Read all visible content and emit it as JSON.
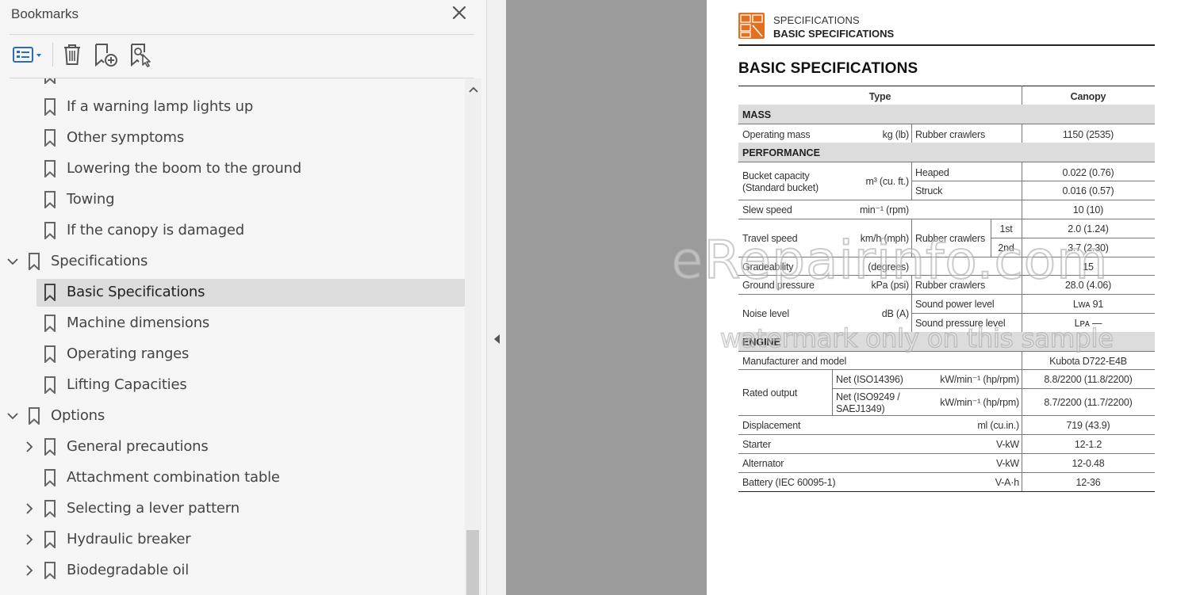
{
  "bookmarks_panel": {
    "title": "Bookmarks",
    "items": [
      {
        "label": "If a warning lamp lights up",
        "level": 2,
        "expandable": false,
        "expanded": false,
        "selected": false
      },
      {
        "label": "Other symptoms",
        "level": 2,
        "expandable": false,
        "expanded": false,
        "selected": false
      },
      {
        "label": "Lowering the boom to the ground",
        "level": 2,
        "expandable": false,
        "expanded": false,
        "selected": false
      },
      {
        "label": "Towing",
        "level": 2,
        "expandable": false,
        "expanded": false,
        "selected": false
      },
      {
        "label": "If the canopy is damaged",
        "level": 2,
        "expandable": false,
        "expanded": false,
        "selected": false
      },
      {
        "label": "Specifications",
        "level": 1,
        "expandable": true,
        "expanded": true,
        "selected": false
      },
      {
        "label": "Basic Specifications",
        "level": 2,
        "expandable": false,
        "expanded": false,
        "selected": true
      },
      {
        "label": "Machine dimensions",
        "level": 2,
        "expandable": false,
        "expanded": false,
        "selected": false
      },
      {
        "label": "Operating ranges",
        "level": 2,
        "expandable": false,
        "expanded": false,
        "selected": false
      },
      {
        "label": "Lifting Capacities",
        "level": 2,
        "expandable": false,
        "expanded": false,
        "selected": false
      },
      {
        "label": "Options",
        "level": 1,
        "expandable": true,
        "expanded": true,
        "selected": false
      },
      {
        "label": "General precautions",
        "level": 2,
        "expandable": true,
        "expanded": false,
        "selected": false
      },
      {
        "label": "Attachment combination table",
        "level": 2,
        "expandable": false,
        "expanded": false,
        "selected": false
      },
      {
        "label": "Selecting a lever pattern",
        "level": 2,
        "expandable": true,
        "expanded": false,
        "selected": false
      },
      {
        "label": "Hydraulic breaker",
        "level": 2,
        "expandable": true,
        "expanded": false,
        "selected": false
      },
      {
        "label": "Biodegradable oil",
        "level": 2,
        "expandable": true,
        "expanded": false,
        "selected": false
      }
    ],
    "toolbar_icons": [
      "options-list-icon",
      "delete-bookmark-icon",
      "new-bookmark-icon",
      "find-bookmark-icon"
    ]
  },
  "document": {
    "header_section": "SPECIFICATIONS",
    "header_subtitle": "BASIC SPECIFICATIONS",
    "page_title": "BASIC SPECIFICATIONS",
    "table": {
      "col_type": "Type",
      "col_canopy": "Canopy",
      "mass": {
        "section": "MASS",
        "operating_mass": "Operating mass",
        "operating_mass_unit": "kg (lb)",
        "operating_mass_cond": "Rubber crawlers",
        "operating_mass_val": "1150 (2535)"
      },
      "performance": {
        "section": "PERFORMANCE",
        "bucket_label_1": "Bucket capacity",
        "bucket_label_2": "(Standard bucket)",
        "bucket_unit": "m³ (cu. ft.)",
        "heaped": "Heaped",
        "heaped_val": "0.022 (0.76)",
        "struck": "Struck",
        "struck_val": "0.016 (0.57)",
        "slew": "Slew speed",
        "slew_unit": "min⁻¹ (rpm)",
        "slew_val": "10 (10)",
        "travel": "Travel speed",
        "travel_unit": "km/h (mph)",
        "travel_cond": "Rubber crawlers",
        "first": "1st",
        "first_val": "2.0 (1.24)",
        "second": "2nd",
        "second_val": "3.7 (2.30)",
        "grade": "Gradeability",
        "grade_unit": "(degrees)",
        "grade_val": "15",
        "ground": "Ground pressure",
        "ground_unit": "kPa (psi)",
        "ground_cond": "Rubber crawlers",
        "ground_val": "28.0 (4.06)",
        "noise": "Noise level",
        "noise_unit": "dB (A)",
        "sound_power": "Sound power level",
        "sound_power_val": "Lᴡᴀ 91",
        "sound_pressure": "Sound pressure level",
        "sound_pressure_val": "Lᴘᴀ —"
      },
      "engine": {
        "section": "ENGINE",
        "manufacturer": "Manufacturer and model",
        "manufacturer_val": "Kubota D722-E4B",
        "rated": "Rated output",
        "net_iso14396": "Net (ISO14396)",
        "net_iso14396_unit": "kW/min⁻¹ (hp/rpm)",
        "net_iso14396_val": "8.8/2200 (11.8/2200)",
        "net_iso9249_1": "Net (ISO9249 /",
        "net_iso9249_2": "SAEJ1349)",
        "net_iso9249_unit": "kW/min⁻¹ (hp/rpm)",
        "net_iso9249_val": "8.7/2200 (11.7/2200)",
        "displacement": "Displacement",
        "displacement_unit": "ml (cu.in.)",
        "displacement_val": "719 (43.9)",
        "starter": "Starter",
        "starter_unit": "V-kW",
        "starter_val": "12-1.2",
        "alternator": "Alternator",
        "alternator_unit": "V-kW",
        "alternator_val": "12-0.48",
        "battery": "Battery (IEC 60095-1)",
        "battery_unit": "V-A·h",
        "battery_val": "12-36"
      }
    },
    "watermark_main": "eRepairinfo.com",
    "watermark_sub": "watermark only on this sample"
  },
  "colors": {
    "panel_bg": "#f5f5f5",
    "selected_bg": "#dcdcdc",
    "doc_gray": "#9b9b9b",
    "accent_blue": "#2a6ebb",
    "logo_orange": "#e2701f"
  }
}
